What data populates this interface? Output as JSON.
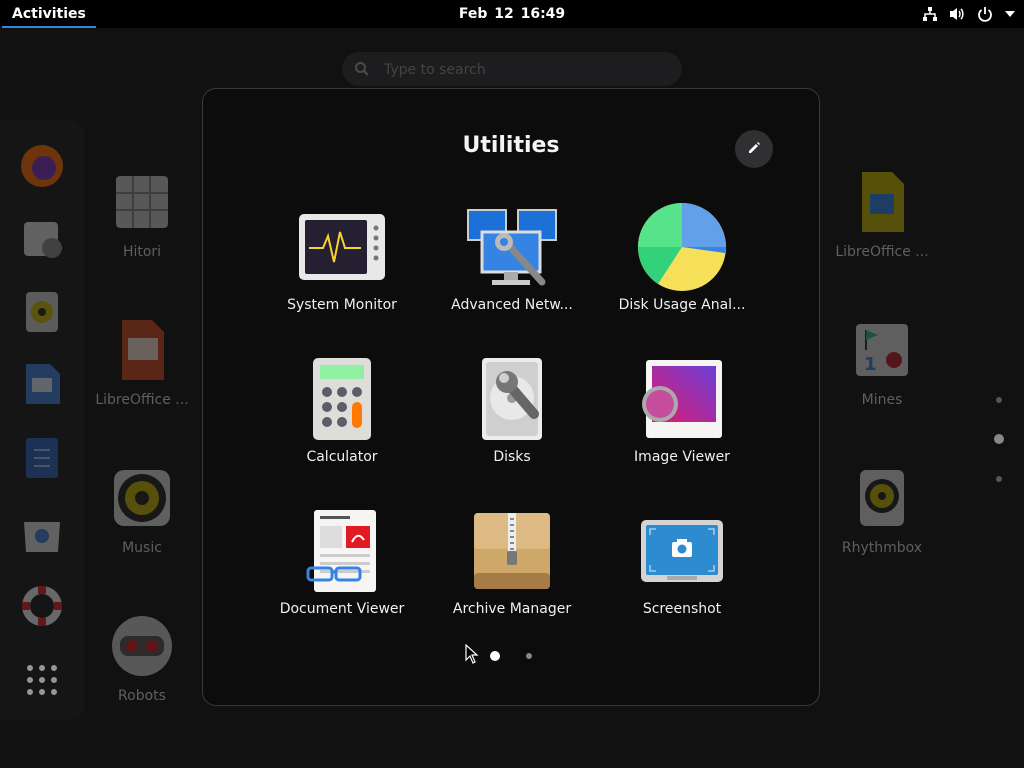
{
  "topbar": {
    "activities_label": "Activities",
    "clock": "Feb 12  16:49",
    "tray": [
      "network-icon",
      "volume-icon",
      "power-icon",
      "menu-arrow-icon"
    ]
  },
  "search": {
    "placeholder": "Type to search"
  },
  "dash": {
    "items": [
      "Firefox",
      "Clocks",
      "Rhythmbox",
      "LibreOffice Writer",
      "Text Editor",
      "Software",
      "Help",
      "Show Applications"
    ]
  },
  "background_apps": [
    {
      "label": "Hitori"
    },
    {
      "label": "LibreOffice ..."
    },
    {
      "label": "Music"
    },
    {
      "label": "Robots"
    },
    {
      "label": "LibreOffice ..."
    },
    {
      "label": "Mines"
    },
    {
      "label": "Rhythmbox"
    }
  ],
  "folder": {
    "title": "Utilities",
    "edit_icon": "pencil-icon",
    "apps": [
      {
        "label": "System Monitor",
        "icon": "system-monitor-icon"
      },
      {
        "label": "Advanced Netw...",
        "icon": "network-connections-icon"
      },
      {
        "label": "Disk Usage Anal...",
        "icon": "disk-usage-pie-icon"
      },
      {
        "label": "Calculator",
        "icon": "calculator-icon"
      },
      {
        "label": "Disks",
        "icon": "disks-icon"
      },
      {
        "label": "Image Viewer",
        "icon": "image-viewer-icon"
      },
      {
        "label": "Document Viewer",
        "icon": "document-viewer-icon"
      },
      {
        "label": "Archive Manager",
        "icon": "archive-manager-icon"
      },
      {
        "label": "Screenshot",
        "icon": "screenshot-icon"
      }
    ],
    "pages": 2,
    "current_page": 1
  },
  "colors": {
    "accent": "#3584e4",
    "background": "#111112",
    "folder_bg": "#0c0c0d"
  }
}
